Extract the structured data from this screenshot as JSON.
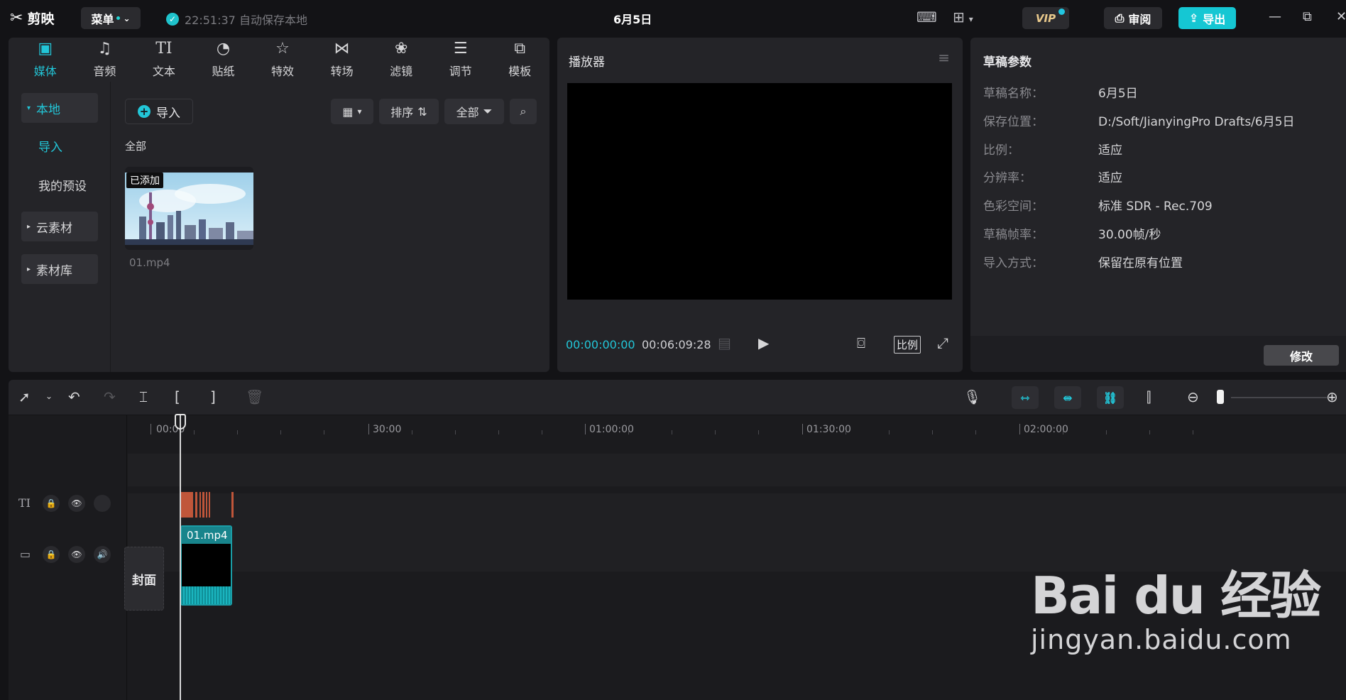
{
  "app": {
    "logo_icon": "✂",
    "name": "剪映",
    "menu_label": "菜单",
    "save_status": "22:51:37 自动保存本地",
    "doc_title": "6月5日"
  },
  "topbar": {
    "vip_label": "VIP",
    "review_label": "审阅",
    "export_label": "导出"
  },
  "toolbar": {
    "tabs": [
      {
        "icon": "▣",
        "label": "媒体"
      },
      {
        "icon": "♫",
        "label": "音频"
      },
      {
        "icon": "TI",
        "label": "文本"
      },
      {
        "icon": "◔",
        "label": "贴纸"
      },
      {
        "icon": "☆",
        "label": "特效"
      },
      {
        "icon": "⋈",
        "label": "转场"
      },
      {
        "icon": "❀",
        "label": "滤镜"
      },
      {
        "icon": "☰",
        "label": "调节"
      },
      {
        "icon": "⧉",
        "label": "模板"
      }
    ],
    "active_index": 0
  },
  "media": {
    "sidebar": {
      "local": "本地",
      "import": "导入",
      "presets": "我的预设",
      "cloud": "云素材",
      "library": "素材库"
    },
    "import_button": "导入",
    "sort_label": "排序",
    "filter_label": "全部",
    "section_label": "全部",
    "clip": {
      "badge": "已添加",
      "name": "01.mp4"
    }
  },
  "player": {
    "title": "播放器",
    "current_time": "00:00:00:00",
    "total_time": "00:06:09:28",
    "ratio_label": "比例"
  },
  "draft": {
    "title": "草稿参数",
    "fields": [
      {
        "key": "草稿名称：",
        "value": "6月5日"
      },
      {
        "key": "保存位置：",
        "value": "D:/Soft/JianyingPro Drafts/6月5日"
      },
      {
        "key": "比例：",
        "value": "适应"
      },
      {
        "key": "分辨率：",
        "value": "适应"
      },
      {
        "key": "色彩空间：",
        "value": "标准 SDR - Rec.709"
      },
      {
        "key": "草稿帧率：",
        "value": "30.00帧/秒"
      },
      {
        "key": "导入方式：",
        "value": "保留在原有位置"
      }
    ],
    "modify_button": "修改"
  },
  "timeline": {
    "ruler": [
      "00:00",
      "30:00",
      "01:00:00",
      "01:30:00",
      "02:00:00"
    ],
    "cover_label": "封面",
    "clip_label": "01.mp4"
  },
  "watermark": {
    "main": "Bai du 经验",
    "sub": "jingyan.baidu.com"
  },
  "colors": {
    "accent": "#22c6d8",
    "export": "#15c7d3",
    "clip": "#18848c",
    "text_track": "#c0563a"
  }
}
